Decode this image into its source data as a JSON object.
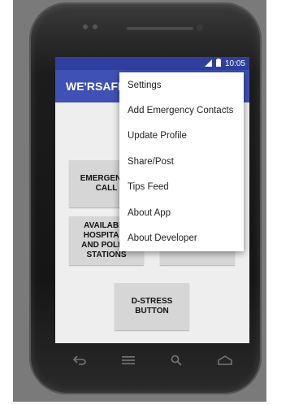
{
  "status": {
    "time": "10:05"
  },
  "app": {
    "title": "WE'RSAFE"
  },
  "buttons": {
    "emergency_call": "EMERGENCY\nCALL",
    "available_stations": "AVAILABLE\nHOSPITALS\nAND POLICE\nSTATIONS",
    "destress": "D-STRESS\nBUTTON"
  },
  "menu": {
    "items": [
      "Settings",
      "Add Emergency Contacts",
      "Update Profile",
      "Share/Post",
      "Tips Feed",
      "About App",
      "About Developer"
    ]
  },
  "icons": {
    "status": [
      "signal-icon",
      "battery-icon"
    ],
    "nav": [
      "back-icon",
      "menu-icon",
      "search-icon",
      "home-icon"
    ]
  }
}
